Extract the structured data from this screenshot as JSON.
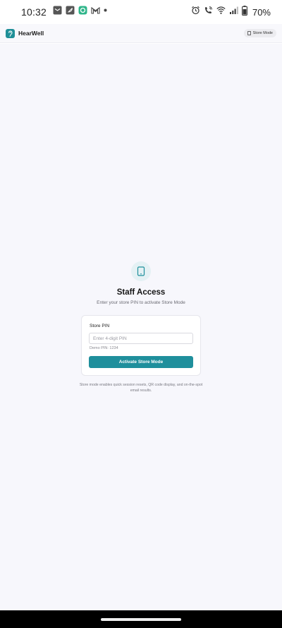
{
  "status_bar": {
    "time": "10:32",
    "battery": "70%",
    "left_icons": [
      "mail-notification-icon",
      "feather-app-icon",
      "green-app-icon",
      "gmail-icon",
      "more-dot-icon"
    ],
    "right_icons": [
      "alarm-icon",
      "wifi-calling-icon",
      "wifi-icon",
      "signal-icon",
      "battery-icon"
    ]
  },
  "header": {
    "brand": "HearWell",
    "store_mode_label": "Store Mode",
    "accent_color": "#1f8f97"
  },
  "staff_access": {
    "title": "Staff Access",
    "subtitle": "Enter your store PIN to activate Store Mode",
    "pin_label": "Store PIN",
    "pin_placeholder": "Enter 4-digit PIN",
    "pin_value": "",
    "demo_hint": "Demo PIN: 1234",
    "activate_label": "Activate Store Mode",
    "button_color": "#1f8f9c"
  },
  "footnote": "Store mode enables quick session resets, QR code display, and on-the-spot email results."
}
